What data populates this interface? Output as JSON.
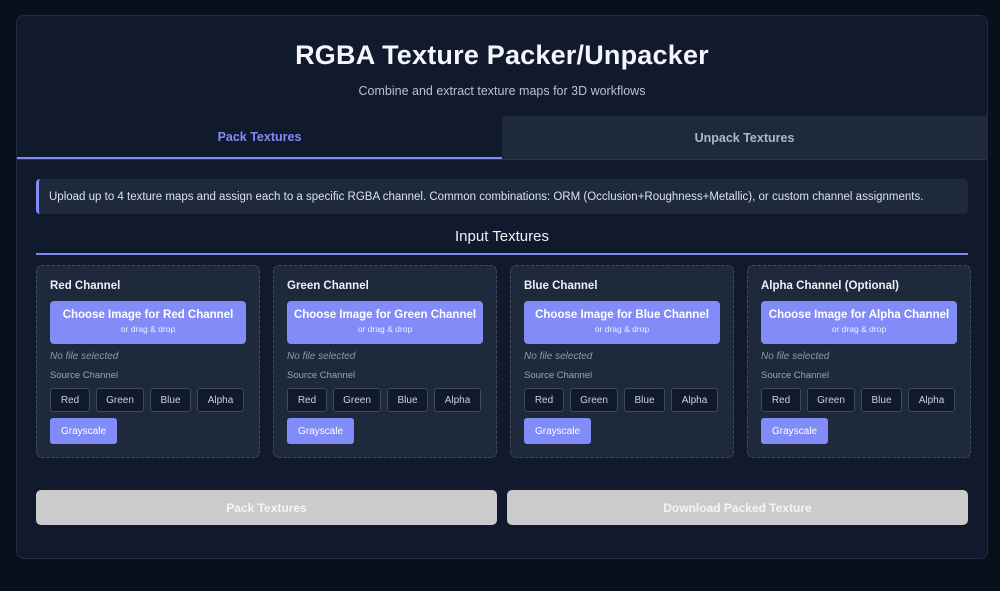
{
  "header": {
    "title": "RGBA Texture Packer/Unpacker",
    "subtitle": "Combine and extract texture maps for 3D workflows"
  },
  "tabs": [
    {
      "label": "Pack Textures",
      "active": true
    },
    {
      "label": "Unpack Textures",
      "active": false
    }
  ],
  "info": {
    "text": "Upload up to 4 texture maps and assign each to a specific RGBA channel. Common combinations: ORM (Occlusion+Roughness+Metallic), or custom channel assignments."
  },
  "section": {
    "title": "Input Textures"
  },
  "channels": [
    {
      "title": "Red Channel",
      "upload_label": "Choose Image for Red Channel",
      "upload_hint": "or drag & drop",
      "file_status": "No file selected",
      "source_label": "Source Channel"
    },
    {
      "title": "Green Channel",
      "upload_label": "Choose Image for Green Channel",
      "upload_hint": "or drag & drop",
      "file_status": "No file selected",
      "source_label": "Source Channel"
    },
    {
      "title": "Blue Channel",
      "upload_label": "Choose Image for Blue Channel",
      "upload_hint": "or drag & drop",
      "file_status": "No file selected",
      "source_label": "Source Channel"
    },
    {
      "title": "Alpha Channel (Optional)",
      "upload_label": "Choose Image for Alpha Channel",
      "upload_hint": "or drag & drop",
      "file_status": "No file selected",
      "source_label": "Source Channel"
    }
  ],
  "source_options": [
    "Red",
    "Green",
    "Blue",
    "Alpha",
    "Grayscale"
  ],
  "actions": {
    "pack_label": "Pack Textures",
    "download_label": "Download Packed Texture"
  },
  "colors": {
    "accent": "#818cf8",
    "background": "#0a0f1c",
    "panel": "#111a2c",
    "card": "#1e293b",
    "disabled_button": "#cbcbcb"
  }
}
